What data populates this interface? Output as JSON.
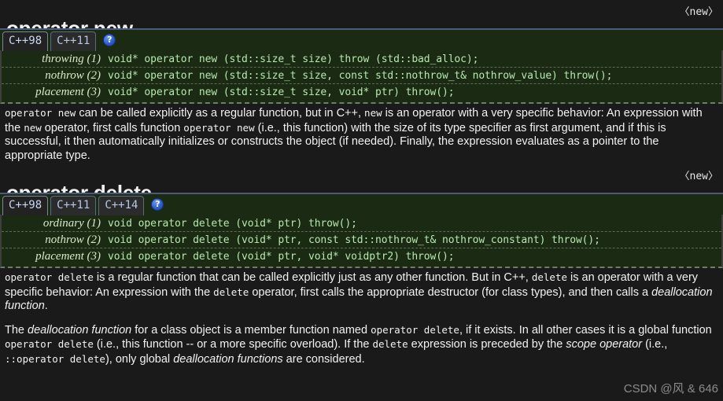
{
  "page": {
    "background_color": "#1a1a1a",
    "code_background_color": "#1b2a12",
    "accent_color": "#2f5fce",
    "watermark": "CSDN @风 & 646"
  },
  "sections": [
    {
      "title": "operator new",
      "header_right": "〈new〉",
      "tabs": [
        {
          "label": "C++98",
          "active": true
        },
        {
          "label": "C++11",
          "active": false
        }
      ],
      "help_icon": "question-mark-icon",
      "help_icon_glyph": "?",
      "signatures": [
        {
          "form": "throwing (1)",
          "code": "void* operator new (std::size_t size) throw (std::bad_alloc);"
        },
        {
          "form": "nothrow (2)",
          "code": "void* operator new (std::size_t size, const std::nothrow_t& nothrow_value) throw();"
        },
        {
          "form": "placement (3)",
          "code": "void* operator new (std::size_t size, void* ptr) throw();"
        }
      ],
      "description_paragraphs": [
        [
          {
            "t": "code",
            "v": "operator new"
          },
          {
            "t": "text",
            "v": " can be called explicitly as a regular function, but in C++, "
          },
          {
            "t": "code",
            "v": "new"
          },
          {
            "t": "text",
            "v": " is an operator with a very specific behavior: An expression with the "
          },
          {
            "t": "code",
            "v": "new"
          },
          {
            "t": "text",
            "v": " operator, first calls function "
          },
          {
            "t": "code",
            "v": "operator new"
          },
          {
            "t": "text",
            "v": " (i.e., this function) with the size of its type specifier as first argument, and if this is successful, it then automatically initializes or constructs the object (if needed). Finally, the expression evaluates as a pointer to the appropriate type."
          }
        ]
      ]
    },
    {
      "title": "operator delete",
      "header_right": "〈new〉",
      "tabs": [
        {
          "label": "C++98",
          "active": true
        },
        {
          "label": "C++11",
          "active": false
        },
        {
          "label": "C++14",
          "active": false
        }
      ],
      "help_icon": "question-mark-icon",
      "help_icon_glyph": "?",
      "signatures": [
        {
          "form": "ordinary (1)",
          "code": "void operator delete (void* ptr) throw();"
        },
        {
          "form": "nothrow (2)",
          "code": "void operator delete (void* ptr, const std::nothrow_t& nothrow_constant) throw();"
        },
        {
          "form": "placement (3)",
          "code": "void operator delete (void* ptr, void* voidptr2) throw();"
        }
      ],
      "description_paragraphs": [
        [
          {
            "t": "code",
            "v": "operator delete"
          },
          {
            "t": "text",
            "v": " is a regular function that can be called explicitly just as any other function. But in C++, "
          },
          {
            "t": "code",
            "v": "delete"
          },
          {
            "t": "text",
            "v": " is an operator with a very specific behavior: An expression with the "
          },
          {
            "t": "code",
            "v": "delete"
          },
          {
            "t": "text",
            "v": " operator, first calls the appropriate destructor (for class types), and then calls a "
          },
          {
            "t": "ital",
            "v": "deallocation function"
          },
          {
            "t": "text",
            "v": "."
          }
        ],
        [
          {
            "t": "text",
            "v": "The "
          },
          {
            "t": "ital",
            "v": "deallocation function"
          },
          {
            "t": "text",
            "v": " for a class object is a member function named "
          },
          {
            "t": "code",
            "v": "operator delete"
          },
          {
            "t": "text",
            "v": ", if it exists. In all other cases it is a global function "
          },
          {
            "t": "code",
            "v": "operator delete"
          },
          {
            "t": "text",
            "v": " (i.e., this function -- or a more specific overload). If the "
          },
          {
            "t": "code",
            "v": "delete"
          },
          {
            "t": "text",
            "v": " expression is preceded by the "
          },
          {
            "t": "ital",
            "v": "scope operator"
          },
          {
            "t": "text",
            "v": " (i.e., "
          },
          {
            "t": "code",
            "v": "::operator delete"
          },
          {
            "t": "text",
            "v": "), only global "
          },
          {
            "t": "ital",
            "v": "deallocation functions"
          },
          {
            "t": "text",
            "v": " are considered."
          }
        ]
      ]
    }
  ]
}
